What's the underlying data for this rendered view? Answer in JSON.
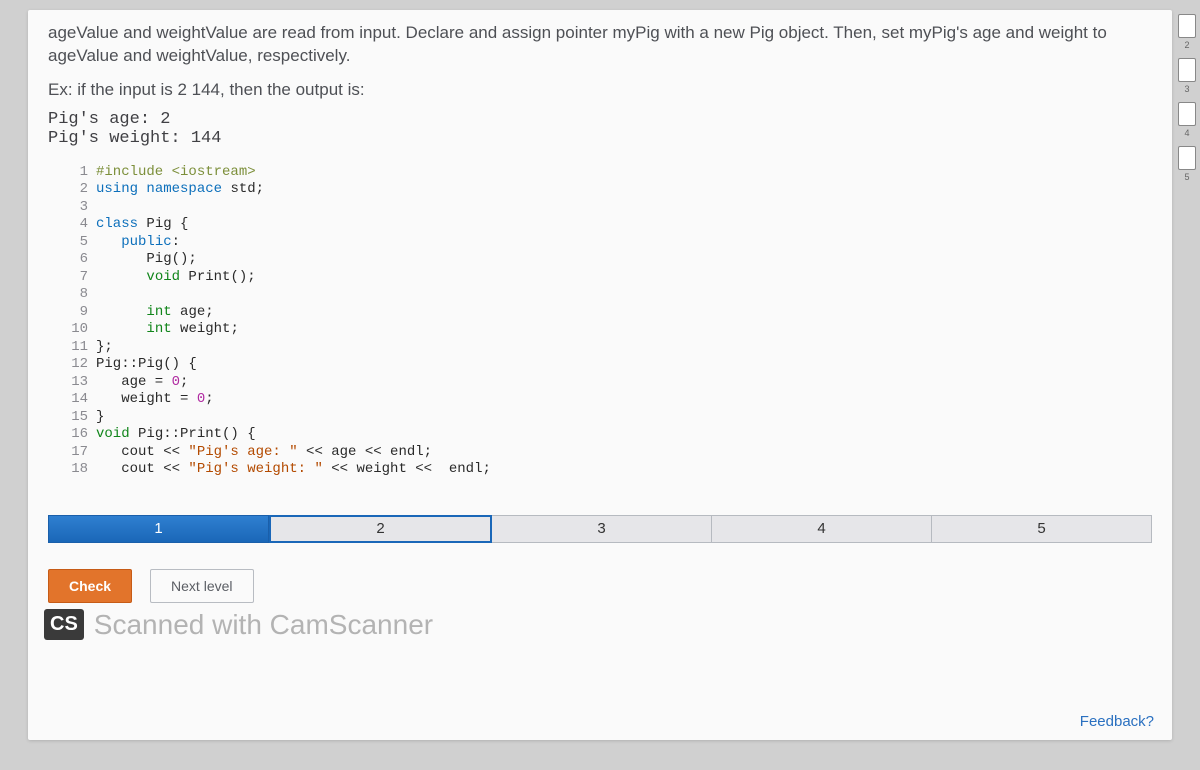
{
  "prompt": "ageValue and weightValue are read from input. Declare and assign pointer myPig with a new Pig object. Then, set myPig's age and weight to ageValue and weightValue, respectively.",
  "example_label": "Ex: if the input is 2  144, then the output is:",
  "sample_output": "Pig's age: 2\nPig's weight: 144",
  "code": {
    "lines": [
      {
        "n": "1",
        "tokens": [
          {
            "t": "#include <iostream>",
            "c": "kw-pre"
          }
        ]
      },
      {
        "n": "2",
        "tokens": [
          {
            "t": "using",
            "c": "kw-blue"
          },
          {
            "t": " "
          },
          {
            "t": "namespace",
            "c": "kw-blue"
          },
          {
            "t": " std;"
          }
        ]
      },
      {
        "n": "3",
        "tokens": []
      },
      {
        "n": "4",
        "tokens": [
          {
            "t": "class",
            "c": "kw-blue"
          },
          {
            "t": " Pig {"
          }
        ]
      },
      {
        "n": "5",
        "tokens": [
          {
            "t": "   "
          },
          {
            "t": "public",
            "c": "kw-blue"
          },
          {
            "t": ":"
          }
        ]
      },
      {
        "n": "6",
        "tokens": [
          {
            "t": "      Pig();"
          }
        ]
      },
      {
        "n": "7",
        "tokens": [
          {
            "t": "      "
          },
          {
            "t": "void",
            "c": "kw-green"
          },
          {
            "t": " Print();"
          }
        ]
      },
      {
        "n": "8",
        "tokens": []
      },
      {
        "n": "9",
        "tokens": [
          {
            "t": "      "
          },
          {
            "t": "int",
            "c": "kw-green"
          },
          {
            "t": " age;"
          }
        ]
      },
      {
        "n": "10",
        "tokens": [
          {
            "t": "      "
          },
          {
            "t": "int",
            "c": "kw-green"
          },
          {
            "t": " weight;"
          }
        ]
      },
      {
        "n": "11",
        "tokens": [
          {
            "t": "};"
          }
        ]
      },
      {
        "n": "12",
        "tokens": [
          {
            "t": "Pig::Pig() {"
          }
        ]
      },
      {
        "n": "13",
        "tokens": [
          {
            "t": "   age = "
          },
          {
            "t": "0",
            "c": "num"
          },
          {
            "t": ";"
          }
        ]
      },
      {
        "n": "14",
        "tokens": [
          {
            "t": "   weight = "
          },
          {
            "t": "0",
            "c": "num"
          },
          {
            "t": ";"
          }
        ]
      },
      {
        "n": "15",
        "tokens": [
          {
            "t": "}"
          }
        ]
      },
      {
        "n": "16",
        "tokens": [
          {
            "t": "void",
            "c": "kw-green"
          },
          {
            "t": " Pig::Print() {"
          }
        ]
      },
      {
        "n": "17",
        "tokens": [
          {
            "t": "   cout << "
          },
          {
            "t": "\"Pig's age: \"",
            "c": "str"
          },
          {
            "t": " << age << endl;"
          }
        ]
      },
      {
        "n": "18",
        "tokens": [
          {
            "t": "   cout << "
          },
          {
            "t": "\"Pig's weight: \"",
            "c": "str"
          },
          {
            "t": " << weight <<  endl;"
          }
        ]
      }
    ]
  },
  "steps": [
    "1",
    "2",
    "3",
    "4",
    "5"
  ],
  "current_step": 0,
  "next_step": 1,
  "buttons": {
    "check": "Check",
    "next": "Next level"
  },
  "watermark": {
    "badge": "CS",
    "text": "Scanned with CamScanner"
  },
  "feedback": "Feedback?",
  "thumbs": [
    "2",
    "3",
    "4",
    "5"
  ]
}
